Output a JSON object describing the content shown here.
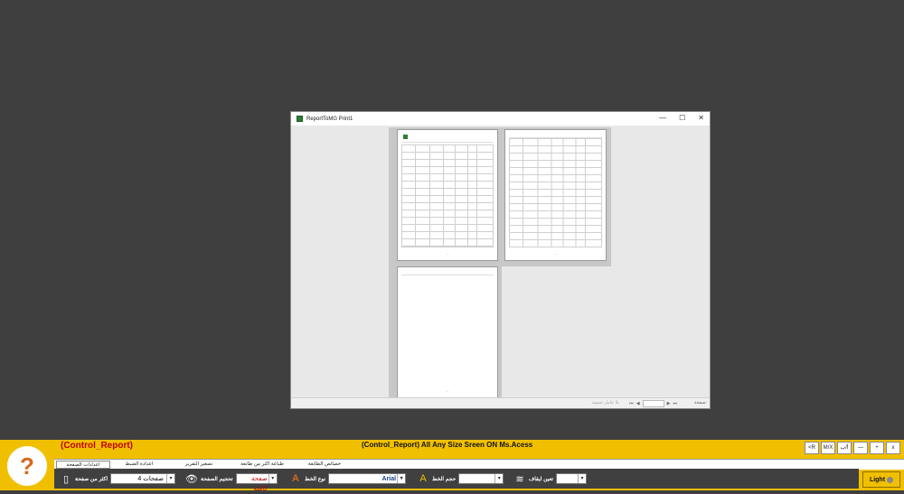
{
  "window": {
    "title": "ReportToMG Print1",
    "minimize": "—",
    "maximize": "☐",
    "close": "✕"
  },
  "status": {
    "filter": "بلا عامل تصفية",
    "page_label": "صفحة:"
  },
  "control": {
    "title_left": "(Control_Report)",
    "title_center": "(Control_Report) All Any Size Sreen ON Ms.Acess",
    "window_buttons": [
      "x",
      "+",
      "—",
      "أ/ب",
      "M/X",
      "<R"
    ],
    "tabs": [
      "اعدادات الصفحة",
      "اعدادة الضبط",
      "تصغير التقرير",
      "طباعة اكثر من طابعة",
      "خصائص الطابعة"
    ],
    "pages_label": "اكثر من صفحة",
    "pages_value": "4 صفحات",
    "view_label": "تحجيم الصفحة",
    "view_value": "صفحة كاملة",
    "font_label": "نوع الخط",
    "font_value": "Arial",
    "size_label": "حجم الخط",
    "size_value": "",
    "copies_label": "تعين ايقاف",
    "copies_value": "",
    "light_label": "Light",
    "colors": {
      "bar": "#f0c000",
      "title_left": "#c00000"
    }
  }
}
